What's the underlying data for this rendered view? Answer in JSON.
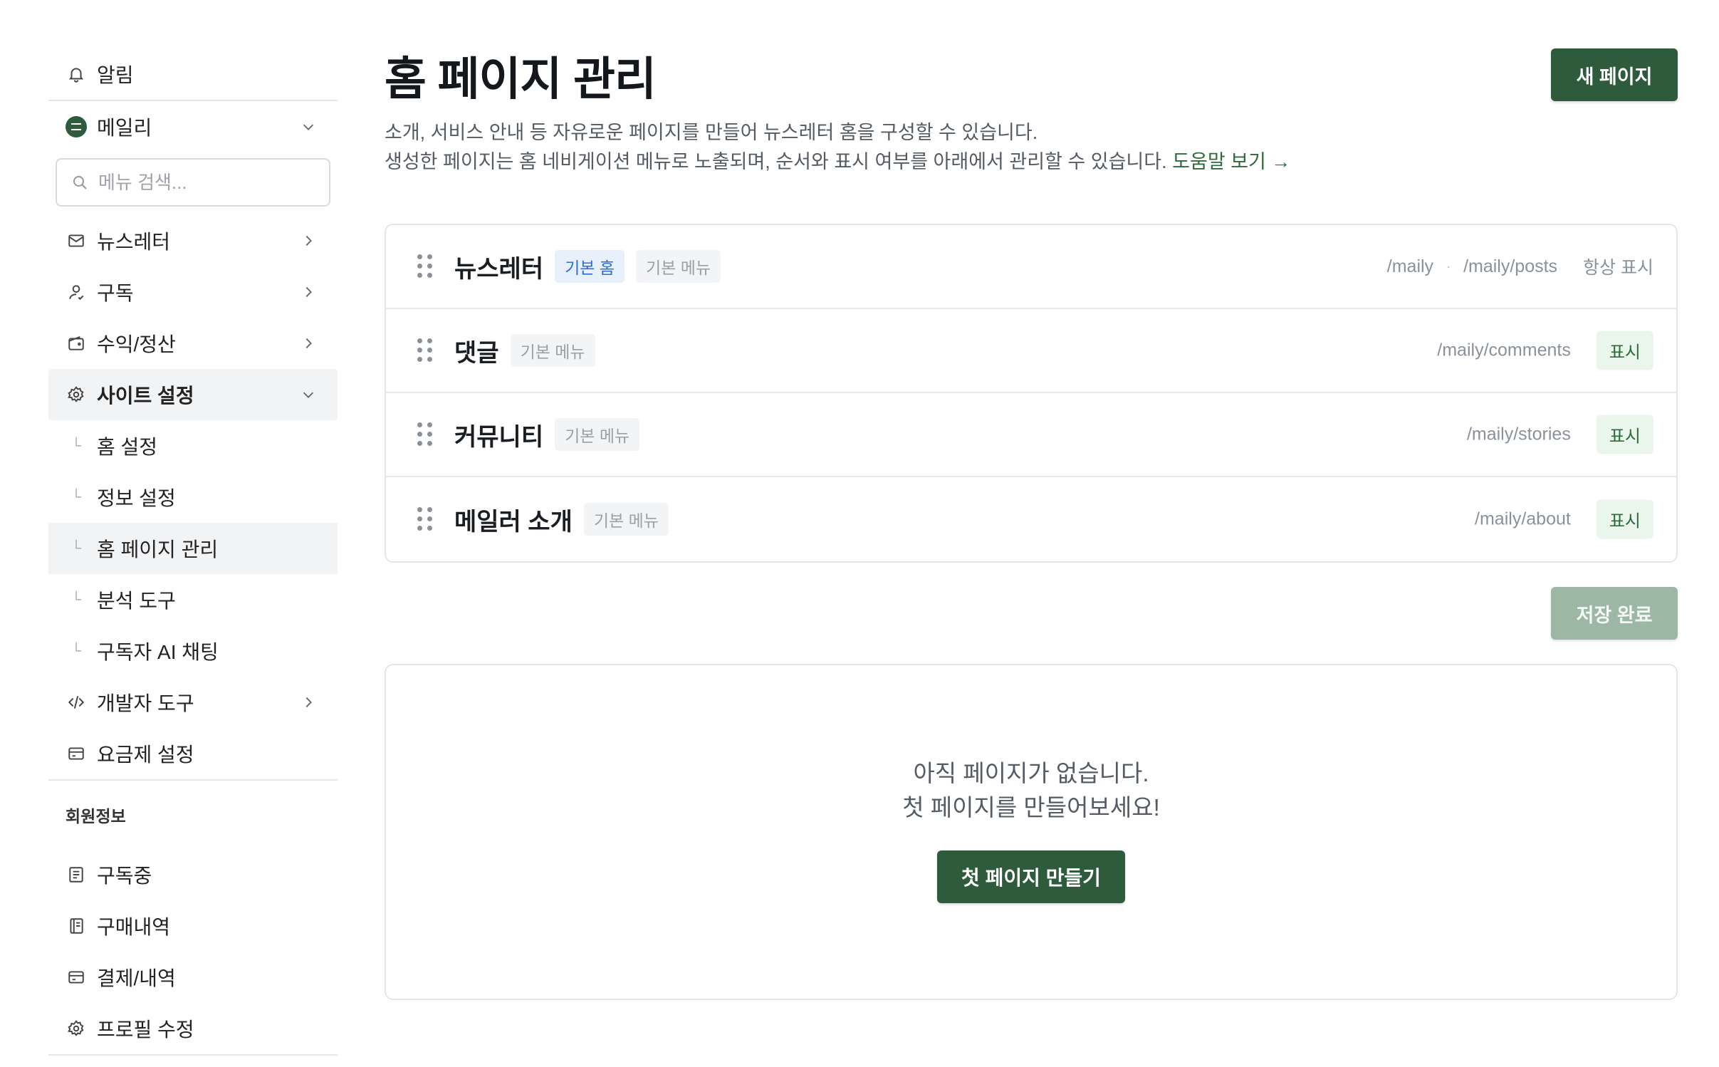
{
  "sidebar": {
    "notifications_label": "알림",
    "site_name": "메일리",
    "search_placeholder": "메뉴 검색...",
    "items": [
      {
        "label": "뉴스레터"
      },
      {
        "label": "구독"
      },
      {
        "label": "수익/정산"
      },
      {
        "label": "사이트 설정"
      }
    ],
    "sub_items": [
      {
        "label": "홈 설정"
      },
      {
        "label": "정보 설정"
      },
      {
        "label": "홈 페이지 관리"
      },
      {
        "label": "분석 도구"
      },
      {
        "label": "구독자 AI 채팅"
      }
    ],
    "dev_tools_label": "개발자 도구",
    "plan_label": "요금제 설정",
    "member_section": "회원정보",
    "member_items": [
      {
        "label": "구독중"
      },
      {
        "label": "구매내역"
      },
      {
        "label": "결제/내역"
      },
      {
        "label": "프로필 수정"
      }
    ]
  },
  "main": {
    "title": "홈 페이지 관리",
    "new_page_button": "새 페이지",
    "desc_line1": "소개, 서비스 안내 등 자유로운 페이지를 만들어 뉴스레터 홈을 구성할 수 있습니다.",
    "desc_line2": "생성한 페이지는 홈 네비게이션 메뉴로 노출되며, 순서와 표시 여부를 아래에서 관리할 수 있습니다.",
    "help_link": "도움말 보기 →",
    "pages": [
      {
        "title": "뉴스레터",
        "tag_home": "기본 홈",
        "tag_menu": "기본 메뉴",
        "path1": "/maily",
        "sep": "·",
        "path2": "/maily/posts",
        "visibility": "항상 표시"
      },
      {
        "title": "댓글",
        "tag_menu": "기본 메뉴",
        "path": "/maily/comments",
        "visibility": "표시"
      },
      {
        "title": "커뮤니티",
        "tag_menu": "기본 메뉴",
        "path": "/maily/stories",
        "visibility": "표시"
      },
      {
        "title": "메일러 소개",
        "tag_menu": "기본 메뉴",
        "path": "/maily/about",
        "visibility": "표시"
      }
    ],
    "save_button": "저장 완료",
    "empty_line1": "아직 페이지가 없습니다.",
    "empty_line2": "첫 페이지를 만들어보세요!",
    "first_page_button": "첫 페이지 만들기"
  },
  "colors": {
    "brand_green": "#2d5b3b",
    "save_disabled": "#9cb8a4",
    "tag_blue": "#2f6fd1"
  }
}
